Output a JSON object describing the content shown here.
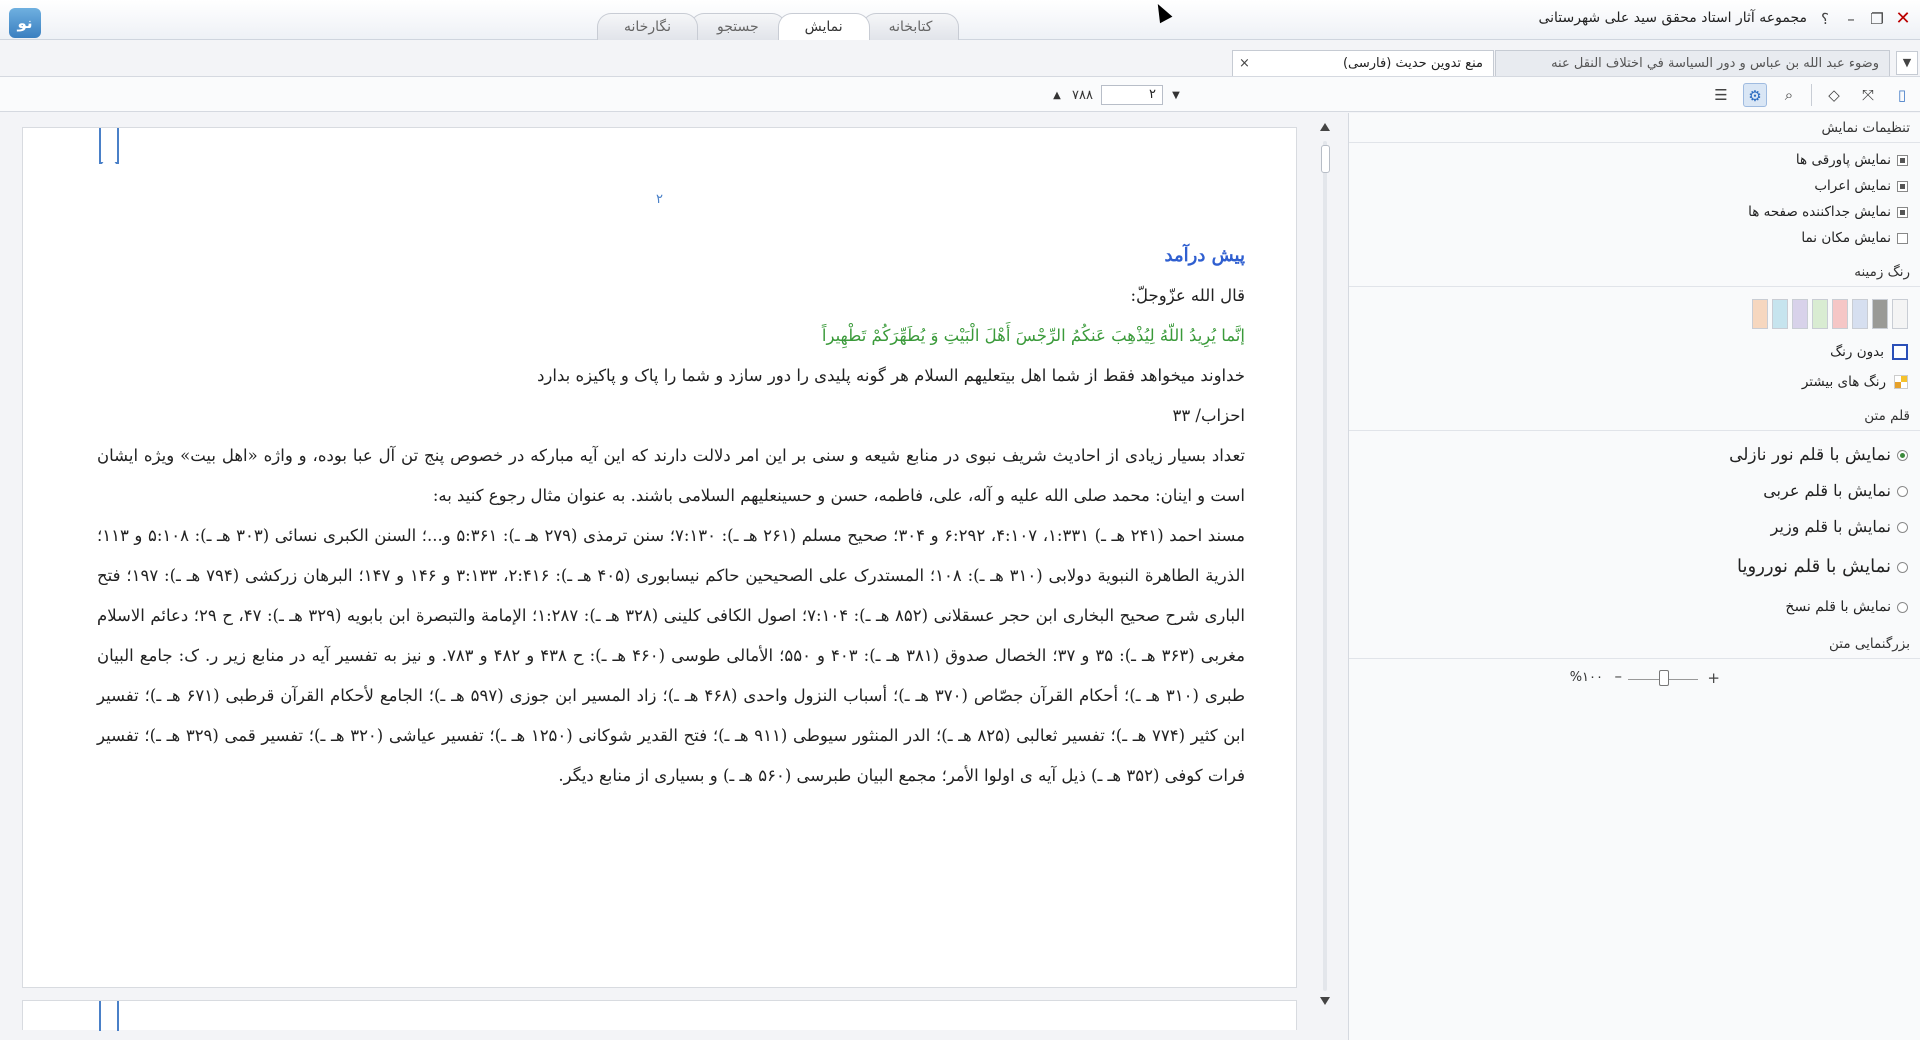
{
  "window": {
    "title": "مجموعه آثار استاد محقق سید علی شهرستانی",
    "help": "؟",
    "minimize": "–",
    "restore": "❐",
    "close": "✕",
    "logo": "نو"
  },
  "main_tabs": [
    {
      "label": "کتابخانه",
      "active": false
    },
    {
      "label": "نمایش",
      "active": true
    },
    {
      "label": "جستجو",
      "active": false
    },
    {
      "label": "نگارخانه",
      "active": false
    }
  ],
  "doc_tabs": [
    {
      "label": "وضوء عبد الله بن عباس و دور السياسة في اختلاف النقل عنه",
      "active": false
    },
    {
      "label": "منع تدوين حديث (فارسی)",
      "active": true,
      "close": "×"
    }
  ],
  "doc_tabs_menu": "▼",
  "pager": {
    "up": "▲",
    "total": "۷۸۸",
    "current": "۲",
    "down": "▼"
  },
  "document": {
    "page_number": "۲",
    "heading": "پیش درآمد",
    "line1": "قال الله عزّوجلّ:",
    "verse": "إنَّما يُرِيدُ اللّهُ لِيُذْهِبَ عَنكُمُ الرِّجْسَ أَهْلَ الْبَيْتِ وَ يُطَهِّرَكُمْ تَطْهِيراً",
    "translation": "خداوند میخواهد فقط از شما اهل بیتعلیهم السلام هر گونه پلیدی را دور سازد و شما را پاک و پاکیزه بدارد",
    "reference": "احزاب/ ۳۳",
    "para1": "تعداد بسیار زیادی از احادیث شریف نبوی در منابع شیعه و سنی بر این امر دلالت دارند که این آیه مبارکه در خصوص پنج تن آل عبا بوده، و واژه «اهل بیت» ویژه ایشان است و اینان: محمد صلی الله علیه و آله، علی، فاطمه، حسن و حسینعلیهم السلامی باشند. به عنوان مثال رجوع کنید به:",
    "para2": "مسند احمد (۲۴۱ هـ ـ) ۱:۳۳۱، ۴:۱۰۷، ۶:۲۹۲ و ۳۰۴؛ صحیح مسلم (۲۶۱ هـ ـ): ۷:۱۳۰؛ سنن ترمذی (۲۷۹ هـ ـ): ۵:۳۶۱ و...؛ السنن الکبری نسائی (۳۰۳ هـ ـ): ۵:۱۰۸ و ۱۱۳؛ الذریة الطاهرة النبویة دولابی (۳۱۰ هـ ـ): ۱۰۸؛ المستدرک علی الصحیحین حاکم نیسابوری (۴۰۵ هـ ـ): ۲:۴۱۶، ۳:۱۳۳ و ۱۴۶ و ۱۴۷؛ البرهان زرکشی (۷۹۴ هـ ـ): ۱۹۷؛ فتح الباری شرح صحیح البخاری ابن حجر عسقلانی (۸۵۲ هـ ـ): ۷:۱۰۴؛ اصول الکافی کلینی (۳۲۸ هـ ـ): ۱:۲۸۷؛ الإمامة والتبصرة ابن بابویه (۳۲۹ هـ ـ): ۴۷، ح ۲۹؛ دعائم الاسلام مغربی (۳۶۳ هـ ـ): ۳۵ و ۳۷؛ الخصال صدوق (۳۸۱ هـ ـ): ۴۰۳ و ۵۵۰؛ الأمالی طوسی (۴۶۰ هـ ـ): ح ۴۳۸ و ۴۸۲ و ۷۸۳. و نیز به تفسیر آیه در منابع زیر ر. ک: جامع البیان طبری (۳۱۰ هـ ـ)؛ أحکام القرآن جصّاص (۳۷۰ هـ ـ)؛ أسباب النزول واحدی (۴۶۸ هـ ـ)؛ زاد المسیر ابن جوزی (۵۹۷ هـ ـ)؛ الجامع لأحکام القرآن قرطبی (۶۷۱ هـ ـ)؛ تفسیر ابن کثیر (۷۷۴ هـ ـ)؛ تفسیر ثعالبی (۸۲۵ هـ ـ)؛ الدر المنثور سیوطی (۹۱۱ هـ ـ)؛ فتح القدیر شوکانی (۱۲۵۰ هـ ـ)؛ تفسیر عیاشی (۳۲۰ هـ ـ)؛ تفسیر قمی (۳۲۹ هـ ـ)؛ تفسیر فرات کوفی (۳۵۲ هـ ـ) ذیل آیه ی اولوا الأمر؛ مجمع البیان طبرسی (۵۶۰ هـ ـ) و بسیاری از منابع دیگر."
  },
  "panel": {
    "display_title": "تنظیمات نمایش",
    "options": [
      {
        "label": "نمایش پاورقی ها",
        "checked": true
      },
      {
        "label": "نمایش اعراب",
        "checked": true
      },
      {
        "label": "نمایش جداکننده صفحه ها",
        "checked": true
      },
      {
        "label": "نمایش مکان نما",
        "checked": false
      }
    ],
    "bg_title": "رنگ زمینه",
    "swatch_colors": [
      "#f4f4f4",
      "#9a9a96",
      "#d6dff0",
      "#f5c6c6",
      "#d9ecd2",
      "#d8d2ea",
      "#c6e4ee",
      "#f6d7bf"
    ],
    "no_color": "بدون رنگ",
    "more_colors": "رنگ های بیشتر",
    "font_title": "قلم متن",
    "fonts": [
      {
        "label": "نمایش با قلم نور نازلی",
        "checked": true
      },
      {
        "label": "نمایش با قلم عربی",
        "checked": false
      },
      {
        "label": "نمایش با قلم وزیر",
        "checked": false
      },
      {
        "label": "نمایش با قلم نوررویا",
        "checked": false
      },
      {
        "label": "نمایش با قلم نسخ",
        "checked": false
      }
    ],
    "zoom_title": "بزرگنمایی متن",
    "zoom_plus": "+",
    "zoom_minus": "–",
    "zoom_value": "%۱۰۰"
  },
  "colors": {
    "accent": "#2f5fd0",
    "verse": "#3a9a3a",
    "bookmark": "#4a80c8"
  }
}
